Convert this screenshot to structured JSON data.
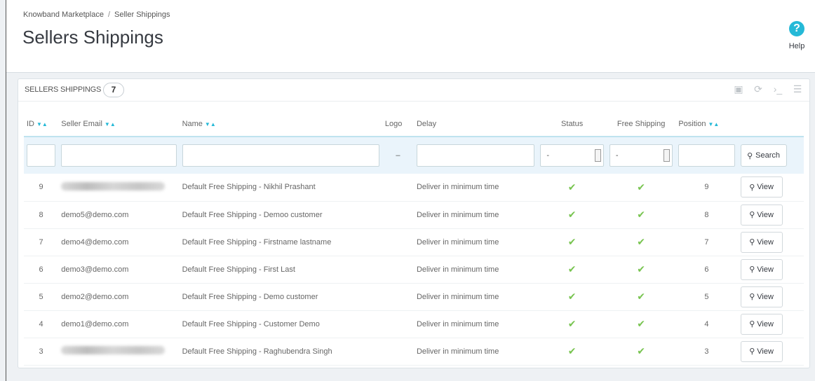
{
  "breadcrumb": {
    "parent": "Knowband Marketplace",
    "current": "Seller Shippings"
  },
  "page_title": "Sellers Shippings",
  "help_label": "Help",
  "panel": {
    "title": "SELLERS SHIPPINGS",
    "count": "7",
    "toolbar_icons": [
      "export-icon",
      "refresh-icon",
      "sql-query-icon",
      "database-icon"
    ]
  },
  "columns": {
    "id": "ID",
    "seller_email": "Seller Email",
    "name": "Name",
    "logo": "Logo",
    "delay": "Delay",
    "status": "Status",
    "free_shipping": "Free Shipping",
    "position": "Position"
  },
  "filters": {
    "logo_placeholder": "–",
    "status_value": "-",
    "free_shipping_value": "-",
    "search_label": "Search"
  },
  "rows": [
    {
      "id": "9",
      "email": "",
      "email_redacted": true,
      "name": "Default Free Shipping - Nikhil Prashant",
      "delay": "Deliver in minimum time",
      "position": "9",
      "view": "View"
    },
    {
      "id": "8",
      "email": "demo5@demo.com",
      "email_redacted": false,
      "name": "Default Free Shipping - Demoo customer",
      "delay": "Deliver in minimum time",
      "position": "8",
      "view": "View"
    },
    {
      "id": "7",
      "email": "demo4@demo.com",
      "email_redacted": false,
      "name": "Default Free Shipping - Firstname lastname",
      "delay": "Deliver in minimum time",
      "position": "7",
      "view": "View"
    },
    {
      "id": "6",
      "email": "demo3@demo.com",
      "email_redacted": false,
      "name": "Default Free Shipping - First Last",
      "delay": "Deliver in minimum time",
      "position": "6",
      "view": "View"
    },
    {
      "id": "5",
      "email": "demo2@demo.com",
      "email_redacted": false,
      "name": "Default Free Shipping - Demo customer",
      "delay": "Deliver in minimum time",
      "position": "5",
      "view": "View"
    },
    {
      "id": "4",
      "email": "demo1@demo.com",
      "email_redacted": false,
      "name": "Default Free Shipping - Customer Demo",
      "delay": "Deliver in minimum time",
      "position": "4",
      "view": "View"
    },
    {
      "id": "3",
      "email": "",
      "email_redacted": true,
      "name": "Default Free Shipping - Raghubendra Singh",
      "delay": "Deliver in minimum time",
      "position": "3",
      "view": "View"
    }
  ],
  "colors": {
    "accent": "#25b9d7",
    "check": "#78c450",
    "filter_bg": "#eaf4fb"
  }
}
